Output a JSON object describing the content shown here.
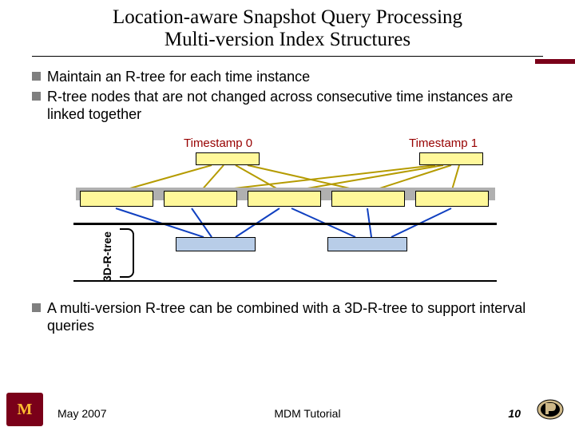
{
  "title": {
    "line1": "Location-aware Snapshot Query Processing",
    "line2": "Multi-version Index Structures"
  },
  "bullets": {
    "b1": "Maintain an R-tree for each time instance",
    "b2": "R-tree nodes that are not changed across consecutive time instances are linked together",
    "b3": "A multi-version R-tree can be combined with a 3D-R-tree to support interval queries"
  },
  "diagram": {
    "ts0": "Timestamp 0",
    "ts1": "Timestamp 1",
    "ylabel": "3D-R-tree"
  },
  "footer": {
    "date": "May 2007",
    "center": "MDM Tutorial",
    "page": "10"
  },
  "logos": {
    "left_letter": "M"
  }
}
